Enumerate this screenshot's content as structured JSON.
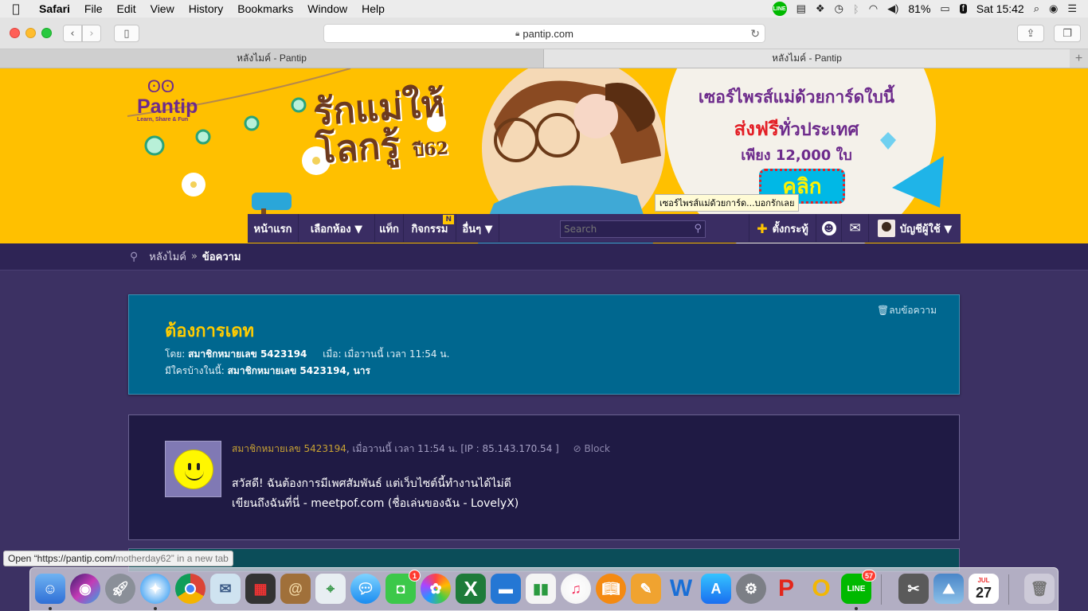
{
  "menubar": {
    "app_name": "Safari",
    "menus": [
      "File",
      "Edit",
      "View",
      "History",
      "Bookmarks",
      "Window",
      "Help"
    ],
    "line_label": "LINE",
    "battery": "81%",
    "clock": "Sat 15:42"
  },
  "toolbar": {
    "url": "pantip.com"
  },
  "tabs": [
    {
      "title": "หลังไมค์ - Pantip"
    },
    {
      "title": "หลังไมค์ - Pantip"
    }
  ],
  "banner": {
    "logo_name": "Pantip",
    "logo_slogan": "Learn, Share & Fun",
    "campaign_title": "รักแม่ให้โลกรู้",
    "campaign_year": "ปี62",
    "promo_line1": "เซอร์ไพรส์แม่ด้วยการ์ดใบนี้",
    "promo_line2_highlight": "ส่งฟรี",
    "promo_line2_rest": "ทั่วประเทศ",
    "promo_line3": "เพียง 12,000 ใบ",
    "promo_button": "คลิก",
    "tooltip": "เซอร์ไพรส์แม่ด้วยการ์ด...บอกรักเลย"
  },
  "nav": {
    "home": "หน้าแรก",
    "rooms": "เลือกห้อง ▼",
    "tags": "แท็ก",
    "activities": "กิจกรรม",
    "activities_badge": "N",
    "more": "อื่นๆ ▼",
    "search_placeholder": "Search",
    "new_topic": "ตั้งกระทู้",
    "account": "บัญชีผู้ใช้ ▼"
  },
  "breadcrumb": {
    "parent": "หลังไมค์",
    "separator": "»",
    "current": "ข้อความ"
  },
  "topic": {
    "delete_label": "ลบข้อความ",
    "title": "ต้องการเดท",
    "by_label": "โดย:",
    "by_user": "สมาชิกหมายเลข 5423194",
    "when_label": "เมื่อ: เมื่อวานนี้ เวลา 11:54 น.",
    "members_label": "มีใครบ้างในนี้:",
    "members": "สมาชิกหมายเลข 5423194, นาร"
  },
  "post": {
    "author": "สมาชิกหมายเลข 5423194",
    "meta_rest": ", เมื่อวานนี้ เวลา 11:54 น. [IP : 85.143.170.54 ]",
    "block_label": "Block",
    "line1": "สวัสดี! ฉันต้องการมีเพศสัมพันธ์ แต่เว็บไซต์นี้ทำงานได้ไม่ดี",
    "line2": "เขียนถึงฉันที่นี่ - meetpof.com (ชื่อเล่นของฉัน - LovelyX)"
  },
  "status_link": {
    "prefix": "Open “https://pantip.com/",
    "suffix": "motherday62” in a new tab"
  },
  "dock": {
    "facetime_badge": "1",
    "line_badge": "57",
    "calendar_month": "JUL",
    "calendar_day": "27"
  }
}
